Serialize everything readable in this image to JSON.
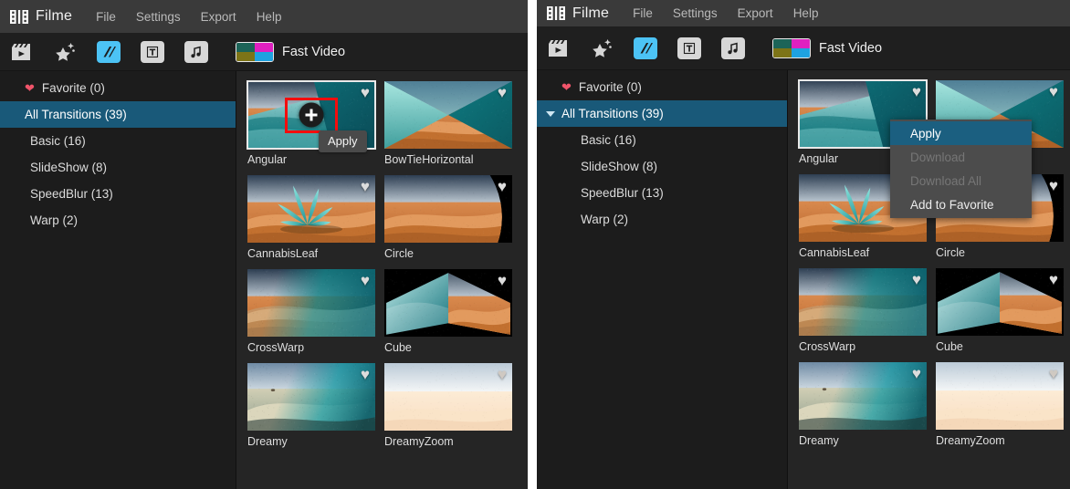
{
  "app": {
    "brand": "Filme",
    "brand_icon": "film-strip-icon",
    "menu": [
      "File",
      "Settings",
      "Export",
      "Help"
    ]
  },
  "toolbar": {
    "buttons": [
      {
        "name": "media-icon",
        "glyph": "clapperboard",
        "active": false
      },
      {
        "name": "effects-icon",
        "glyph": "magic-wand",
        "active": false
      },
      {
        "name": "transitions-icon",
        "glyph": "transition",
        "active": true
      },
      {
        "name": "text-icon",
        "glyph": "T",
        "active": false
      },
      {
        "name": "audio-icon",
        "glyph": "music-note",
        "active": false
      }
    ],
    "fast_video_label": "Fast Video",
    "fast_video_colors": [
      "#1c6458",
      "#e020c0",
      "#7d7417",
      "#1ea2e0"
    ]
  },
  "sidebar": {
    "favorite": {
      "label": "Favorite (0)",
      "icon": "heart-icon"
    },
    "all_transitions": {
      "label": "All Transitions (39)",
      "selected": true,
      "caret": "caret-down-icon"
    },
    "categories": [
      {
        "label": "Basic (16)"
      },
      {
        "label": "SlideShow (8)"
      },
      {
        "label": "SpeedBlur (13)"
      },
      {
        "label": "Warp (2)"
      }
    ]
  },
  "transitions": [
    {
      "name": "Angular",
      "art": "angular",
      "selected": true,
      "fav": "heart-icon"
    },
    {
      "name": "BowTieHorizontal",
      "art": "bowtie",
      "selected": false,
      "fav": "heart-icon"
    },
    {
      "name": "CannabisLeaf",
      "art": "leaf",
      "selected": false,
      "fav": "heart-icon"
    },
    {
      "name": "Circle",
      "art": "circle",
      "selected": false,
      "fav": "heart-icon"
    },
    {
      "name": "CrossWarp",
      "art": "crosswarp",
      "selected": false,
      "fav": "heart-icon"
    },
    {
      "name": "Cube",
      "art": "cube",
      "selected": false,
      "fav": "heart-icon"
    },
    {
      "name": "Dreamy",
      "art": "dreamy",
      "selected": false,
      "fav": "heart-icon"
    },
    {
      "name": "DreamyZoom",
      "art": "dreamyzoom",
      "selected": false,
      "fav": "heart-icon"
    }
  ],
  "left_panel": {
    "plus_button": "add-transition-button",
    "tooltip": "Apply",
    "annotation_color": "#f40d0d"
  },
  "right_panel": {
    "context_menu": [
      {
        "label": "Apply",
        "state": "highlighted"
      },
      {
        "label": "Download",
        "state": "disabled"
      },
      {
        "label": "Download All",
        "state": "disabled"
      },
      {
        "label": "Add to Favorite",
        "state": "normal"
      }
    ],
    "annotation_color": "#f40d0d"
  }
}
